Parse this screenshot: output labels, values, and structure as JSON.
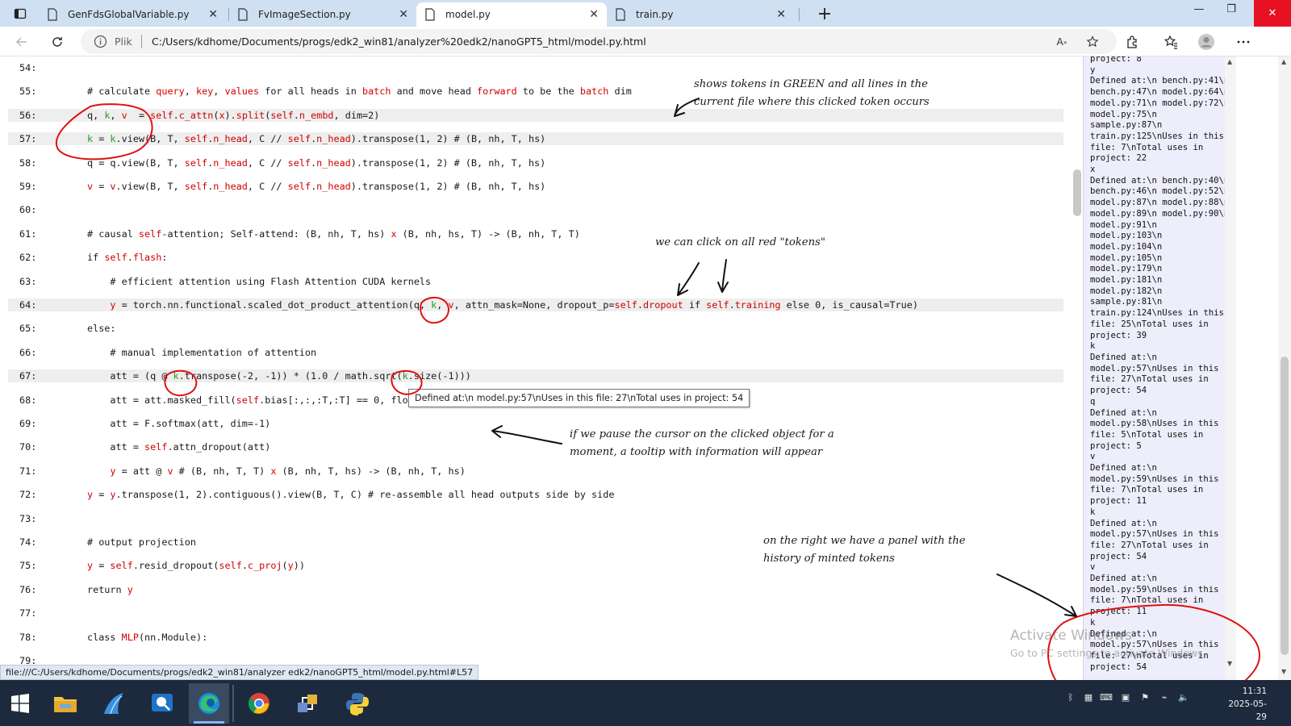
{
  "browser": {
    "tabs": [
      {
        "title": "GenFdsGlobalVariable.py",
        "active": false
      },
      {
        "title": "FvImageSection.py",
        "active": false
      },
      {
        "title": "model.py",
        "active": true
      },
      {
        "title": "train.py",
        "active": false
      }
    ],
    "new_tab_label": "+",
    "address": {
      "scheme_label": "Plik",
      "url": "C:/Users/kdhome/Documents/progs/edk2_win81/analyzer%20edk2/nanoGPT5_html/model.py.html"
    }
  },
  "code": {
    "lines": [
      {
        "num": "54:",
        "text": ""
      },
      {
        "num": "55:",
        "text": "# calculate query, key, values for all heads in batch and move head forward to be the batch dim"
      },
      {
        "num": "56:",
        "text": "q, k, v  = self.c_attn(x).split(self.n_embd, dim=2)"
      },
      {
        "num": "57:",
        "text": "k = k.view(B, T, self.n_head, C // self.n_head).transpose(1, 2) # (B, nh, T, hs)"
      },
      {
        "num": "58:",
        "text": "q = q.view(B, T, self.n_head, C // self.n_head).transpose(1, 2) # (B, nh, T, hs)"
      },
      {
        "num": "59:",
        "text": "v = v.view(B, T, self.n_head, C // self.n_head).transpose(1, 2) # (B, nh, T, hs)"
      },
      {
        "num": "60:",
        "text": ""
      },
      {
        "num": "61:",
        "text": "# causal self-attention; Self-attend: (B, nh, T, hs) x (B, nh, hs, T) -> (B, nh, T, T)"
      },
      {
        "num": "62:",
        "text": "if self.flash:"
      },
      {
        "num": "63:",
        "text": "    # efficient attention using Flash Attention CUDA kernels"
      },
      {
        "num": "64:",
        "text": "    y = torch.nn.functional.scaled_dot_product_attention(q, k, v, attn_mask=None, dropout_p=self.dropout if self.training else 0, is_causal=True)"
      },
      {
        "num": "65:",
        "text": "else:"
      },
      {
        "num": "66:",
        "text": "    # manual implementation of attention"
      },
      {
        "num": "67:",
        "text": "    att = (q @ k.transpose(-2, -1)) * (1.0 / math.sqrt(k.size(-1)))"
      },
      {
        "num": "68:",
        "text": "    att = att.masked_fill(self.bias[:,:,:T,:T] == 0, float('-inf'))"
      },
      {
        "num": "69:",
        "text": "    att = F.softmax(att, dim=-1)"
      },
      {
        "num": "70:",
        "text": "    att = self.attn_dropout(att)"
      },
      {
        "num": "71:",
        "text": "    y = att @ v # (B, nh, T, T) x (B, nh, T, hs) -> (B, nh, T, hs)"
      },
      {
        "num": "72:",
        "text": "y = y.transpose(1, 2).contiguous().view(B, T, C) # re-assemble all head outputs side by side"
      },
      {
        "num": "73:",
        "text": ""
      },
      {
        "num": "74:",
        "text": "# output projection"
      },
      {
        "num": "75:",
        "text": "y = self.resid_dropout(self.c_proj(y))"
      },
      {
        "num": "76:",
        "text": "return y"
      },
      {
        "num": "77:",
        "text": ""
      },
      {
        "num": "78:",
        "text": "class MLP(nn.Module):"
      },
      {
        "num": "79:",
        "text": ""
      }
    ]
  },
  "tooltip": "Defined at:\\n  model.py:57\\nUses in this file: 27\\nTotal uses in project: 54",
  "annotations": {
    "green_tokens": [
      "shows tokens in GREEN and all lines in the",
      "current file where this clicked token occurs"
    ],
    "red_tokens": "we can click on all red \"tokens\"",
    "tooltip_note": [
      "if we pause the cursor on the clicked object for a",
      "moment, a tooltip with information will appear"
    ],
    "panel_note": [
      "on the right we have a panel with the",
      "history of minted tokens"
    ]
  },
  "history_panel": {
    "text": "project: 8\ny\nDefined at:\\n bench.py:41\\n\nbench.py:47\\n model.py:64\\n\nmodel.py:71\\n model.py:72\\n\nmodel.py:75\\n\nsample.py:87\\n\ntrain.py:125\\nUses in this\nfile: 7\\nTotal uses in\nproject: 22\nx\nDefined at:\\n bench.py:40\\n\nbench.py:46\\n model.py:52\\n\nmodel.py:87\\n model.py:88\\n\nmodel.py:89\\n model.py:90\\n\nmodel.py:91\\n\nmodel.py:103\\n\nmodel.py:104\\n\nmodel.py:105\\n\nmodel.py:179\\n\nmodel.py:181\\n\nmodel.py:182\\n\nsample.py:81\\n\ntrain.py:124\\nUses in this\nfile: 25\\nTotal uses in\nproject: 39\nk\nDefined at:\\n\nmodel.py:57\\nUses in this\nfile: 27\\nTotal uses in\nproject: 54\nq\nDefined at:\\n\nmodel.py:58\\nUses in this\nfile: 5\\nTotal uses in\nproject: 5\nv\nDefined at:\\n\nmodel.py:59\\nUses in this\nfile: 7\\nTotal uses in\nproject: 11\nk\nDefined at:\\n\nmodel.py:57\\nUses in this\nfile: 27\\nTotal uses in\nproject: 54\nv\nDefined at:\\n\nmodel.py:59\\nUses in this\nfile: 7\\nTotal uses in\nproject: 11\nk\nDefined at:\\n\nmodel.py:57\\nUses in this\nfile: 27\\nTotal uses in\nproject: 54"
  },
  "watermark": {
    "title": "Activate Windows",
    "subtitle": "Go to PC settings to activate Windows."
  },
  "status_url": "file:///C:/Users/kdhome/Documents/progs/edk2_win81/analyzer edk2/nanoGPT5_html/model.py.html#L57",
  "clock": {
    "time": "11:31",
    "date": "2025-05-29"
  },
  "colors": {
    "token": "#d10000",
    "active_token": "#1e9e1e",
    "highlight_line": "#eeeeee",
    "annotation_ink": "#e01010",
    "panel_bg": "#ededfb"
  },
  "icons": [
    "tab-actions-icon",
    "page-icon",
    "close-icon",
    "back-icon",
    "refresh-icon",
    "info-icon",
    "read-aloud-icon",
    "add-favorite-icon",
    "extensions-icon",
    "favorites-icon",
    "profile-icon",
    "more-icon",
    "start-icon",
    "file-explorer-icon",
    "edge-icon",
    "chrome-icon",
    "python-icon"
  ]
}
